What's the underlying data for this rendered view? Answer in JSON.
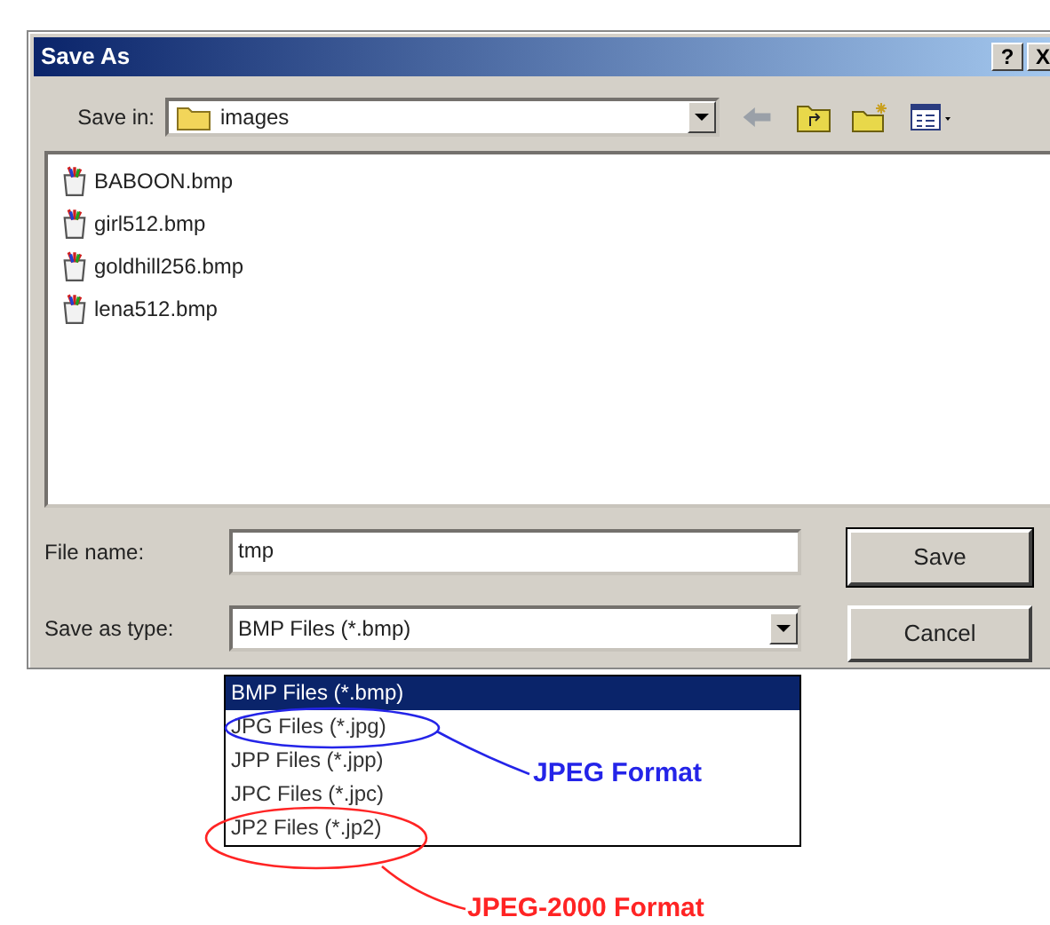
{
  "window": {
    "title": "Save As",
    "help_button": "?",
    "close_button": "X"
  },
  "save_in": {
    "label": "Save in:",
    "value": "images"
  },
  "files": [
    {
      "name": "BABOON.bmp"
    },
    {
      "name": "girl512.bmp"
    },
    {
      "name": "goldhill256.bmp"
    },
    {
      "name": "lena512.bmp"
    }
  ],
  "file_name": {
    "label": "File name:",
    "value": "tmp"
  },
  "save_as_type": {
    "label": "Save as type:",
    "value": "BMP Files (*.bmp)"
  },
  "buttons": [
    {
      "label": "Save",
      "default": true
    },
    {
      "label": "Cancel",
      "default": false
    }
  ],
  "type_options": [
    {
      "label": "BMP Files (*.bmp)",
      "selected": true
    },
    {
      "label": "JPG Files (*.jpg)",
      "selected": false,
      "callout": {
        "text": "JPEG Format",
        "color": "#2424e8"
      }
    },
    {
      "label": "JPP Files (*.jpp)",
      "selected": false
    },
    {
      "label": "JPC Files (*.jpc)",
      "selected": false
    },
    {
      "label": "JP2 Files (*.jp2)",
      "selected": false,
      "callout": {
        "text": "JPEG-2000 Format",
        "color": "#ff2424"
      }
    }
  ]
}
